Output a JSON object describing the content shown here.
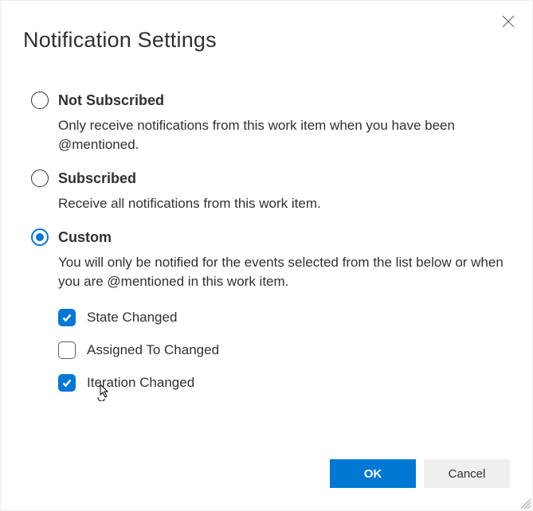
{
  "title": "Notification Settings",
  "options": {
    "not_subscribed": {
      "label": "Not Subscribed",
      "desc": "Only receive notifications from this work item when you have been @mentioned.",
      "selected": false
    },
    "subscribed": {
      "label": "Subscribed",
      "desc": "Receive all notifications from this work item.",
      "selected": false
    },
    "custom": {
      "label": "Custom",
      "desc": "You will only be notified for the events selected from the list below or when you are @mentioned in this work item.",
      "selected": true,
      "items": {
        "state_changed": {
          "label": "State Changed",
          "checked": true
        },
        "assigned_to_changed": {
          "label": "Assigned To Changed",
          "checked": false
        },
        "iteration_changed": {
          "label": "Iteration Changed",
          "checked": true
        }
      }
    }
  },
  "buttons": {
    "ok": "OK",
    "cancel": "Cancel"
  }
}
